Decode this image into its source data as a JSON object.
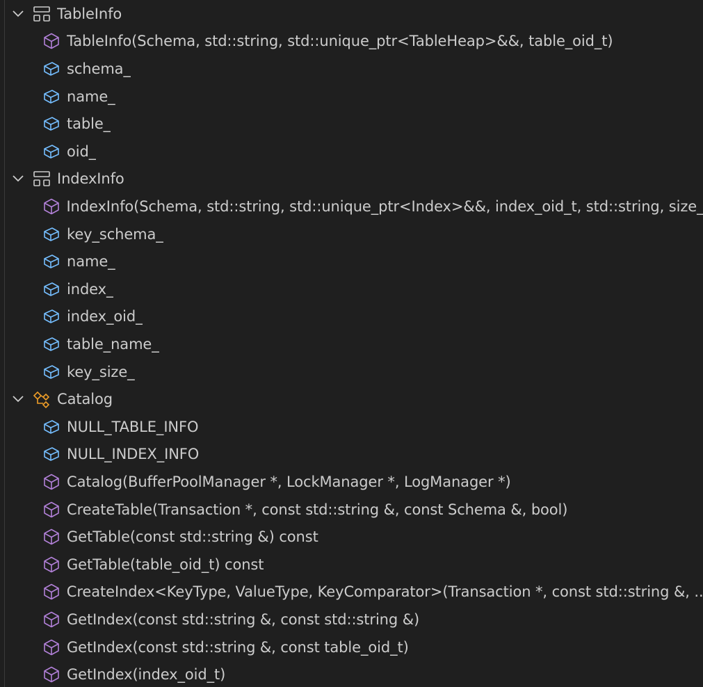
{
  "colors": {
    "background": "#1f1f1f",
    "text": "#cccccc",
    "method_icon": "#b180d7",
    "field_icon": "#75beff",
    "class_icon": "#ee9d28",
    "struct_icon": "#cccccc"
  },
  "outline": [
    {
      "label": "TableInfo",
      "icon": "struct-icon",
      "expanded": true,
      "children": [
        {
          "label": "TableInfo(Schema, std::string, std::unique_ptr<TableHeap>&&, table_oid_t)",
          "icon": "method-icon"
        },
        {
          "label": "schema_",
          "icon": "field-icon"
        },
        {
          "label": "name_",
          "icon": "field-icon"
        },
        {
          "label": "table_",
          "icon": "field-icon"
        },
        {
          "label": "oid_",
          "icon": "field-icon"
        }
      ]
    },
    {
      "label": "IndexInfo",
      "icon": "struct-icon",
      "expanded": true,
      "children": [
        {
          "label": "IndexInfo(Schema, std::string, std::unique_ptr<Index>&&, index_oid_t, std::string, size_t)",
          "icon": "method-icon"
        },
        {
          "label": "key_schema_",
          "icon": "field-icon"
        },
        {
          "label": "name_",
          "icon": "field-icon"
        },
        {
          "label": "index_",
          "icon": "field-icon"
        },
        {
          "label": "index_oid_",
          "icon": "field-icon"
        },
        {
          "label": "table_name_",
          "icon": "field-icon"
        },
        {
          "label": "key_size_",
          "icon": "field-icon"
        }
      ]
    },
    {
      "label": "Catalog",
      "icon": "class-icon",
      "expanded": true,
      "children": [
        {
          "label": "NULL_TABLE_INFO",
          "icon": "field-icon"
        },
        {
          "label": "NULL_INDEX_INFO",
          "icon": "field-icon"
        },
        {
          "label": "Catalog(BufferPoolManager *, LockManager *, LogManager *)",
          "icon": "method-icon"
        },
        {
          "label": "CreateTable(Transaction *, const std::string &, const Schema &, bool)",
          "icon": "method-icon"
        },
        {
          "label": "GetTable(const std::string &) const",
          "icon": "method-icon"
        },
        {
          "label": "GetTable(table_oid_t) const",
          "icon": "method-icon"
        },
        {
          "label": "CreateIndex<KeyType, ValueType, KeyComparator>(Transaction *, const std::string &, ...",
          "icon": "method-icon"
        },
        {
          "label": "GetIndex(const std::string &, const std::string &)",
          "icon": "method-icon"
        },
        {
          "label": "GetIndex(const std::string &, const table_oid_t)",
          "icon": "method-icon"
        },
        {
          "label": "GetIndex(index_oid_t)",
          "icon": "method-icon"
        }
      ]
    }
  ]
}
